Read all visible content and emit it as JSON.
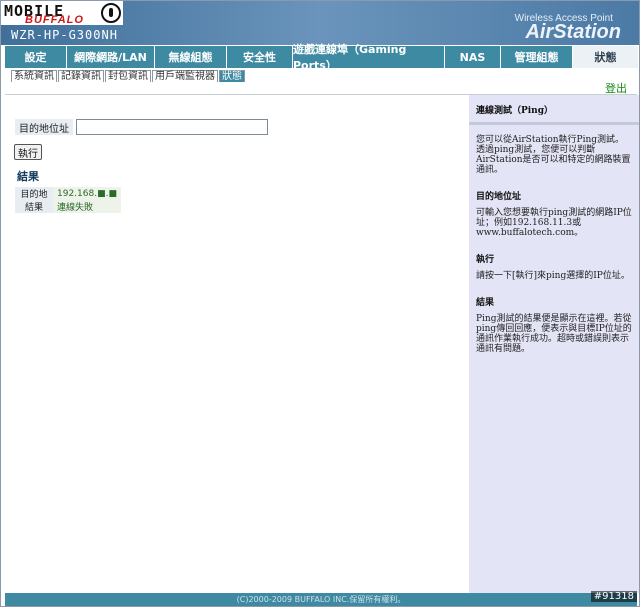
{
  "brand": {
    "watermark_left": "MOBILE",
    "watermark_brand": "BUFFALO",
    "model": "WZR-HP-G300NH",
    "subtitle": "Wireless Access Point",
    "product": "AirStation"
  },
  "nav": {
    "items": [
      {
        "label": "設定"
      },
      {
        "label": "網際網路/LAN"
      },
      {
        "label": "無線組態"
      },
      {
        "label": "安全性"
      },
      {
        "label": "遊戲連線埠（Gaming Ports）"
      },
      {
        "label": "NAS"
      },
      {
        "label": "管理組態"
      },
      {
        "label": "狀態"
      }
    ],
    "active_index": 7
  },
  "subnav": {
    "items": [
      {
        "label": "系統資訊"
      },
      {
        "label": "記錄資訊"
      },
      {
        "label": "封包資訊"
      },
      {
        "label": "用戶端監視器"
      },
      {
        "label": "狀態"
      }
    ],
    "active_index": 4
  },
  "logout_label": "登出",
  "ping_form": {
    "target_label": "目的地位址",
    "target_value": "",
    "exec_label": "執行"
  },
  "result": {
    "heading": "結果",
    "rows": [
      {
        "key": "目的地",
        "value": "192.168.■.■"
      },
      {
        "key": "結果",
        "value": "連線失敗"
      }
    ]
  },
  "help": {
    "title": "連線測試（Ping）",
    "intro": "您可以從AirStation執行Ping測試。透過ping測試，您便可以判斷AirStation是否可以和特定的網路裝置通訊。",
    "sections": [
      {
        "title": "目的地位址",
        "text": "可輸入您想要執行ping測試的網路IP位址；例如192.168.11.3或www.buffalotech.com。"
      },
      {
        "title": "執行",
        "text": "請按一下[執行]來ping選擇的IP位址。"
      },
      {
        "title": "結果",
        "text": "Ping測試的結果便是顯示在這裡。若從ping傳回回應，便表示與目標IP位址的通訊作業執行成功。超時或錯誤則表示通訊有問題。"
      }
    ]
  },
  "footer": "(C)2000-2009 BUFFALO INC.保留所有權利。",
  "watermark_id": "#91318",
  "colors": {
    "nav_bg": "#3e8aa3",
    "help_bg": "#e3e4f5",
    "logout": "#138a13"
  }
}
